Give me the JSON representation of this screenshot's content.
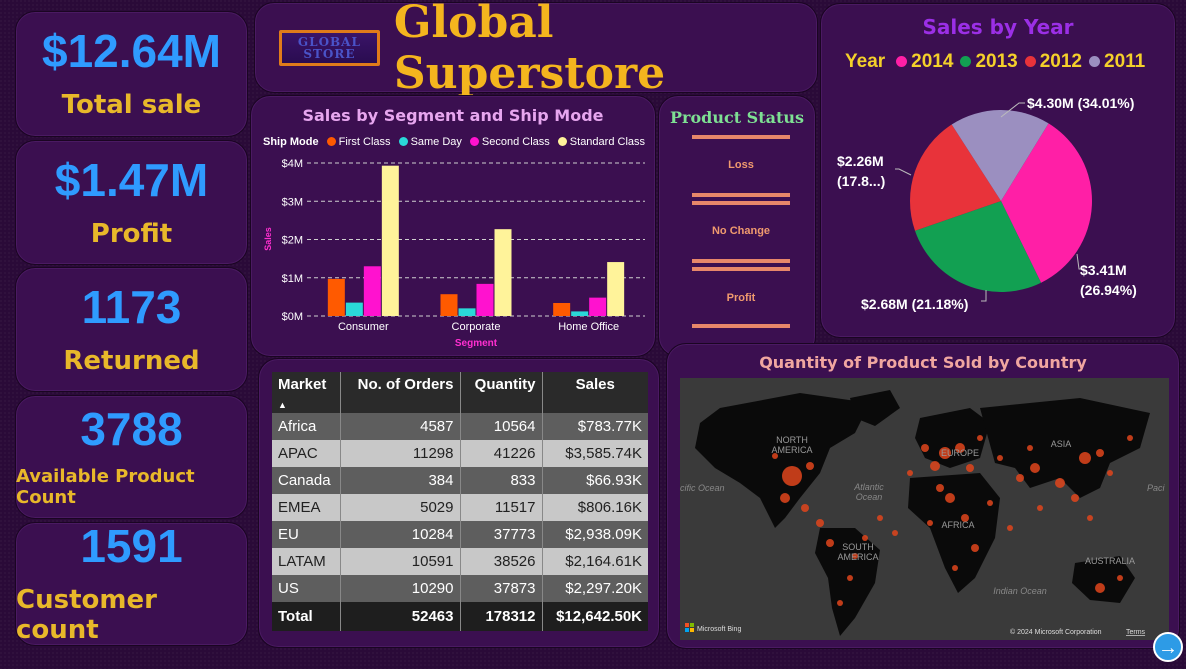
{
  "kpis": [
    {
      "value": "$12.64M",
      "label": "Total sale"
    },
    {
      "value": "$1.47M",
      "label": "Profit"
    },
    {
      "value": "1173",
      "label": "Returned"
    },
    {
      "value": "3788",
      "label": "Available Product Count"
    },
    {
      "value": "1591",
      "label": "Customer count"
    }
  ],
  "header": {
    "logo_line1": "GLOBAL",
    "logo_line2": "STORE",
    "title": "Global Superstore"
  },
  "segment_chart": {
    "title": "Sales by Segment and Ship Mode",
    "legend_title": "Ship Mode",
    "xlabel": "Segment",
    "ylabel": "Sales"
  },
  "product_status": {
    "title": "Product Status",
    "items": [
      "Loss",
      "No Change",
      "Profit"
    ]
  },
  "year_chart": {
    "title": "Sales by Year",
    "legend_title": "Year",
    "slice_labels": {
      "s2014": "$4.30M (34.01%)",
      "s2013_line1": "$3.41M",
      "s2013_line2": "(26.94%)",
      "s2012": "$2.68M (21.18%)",
      "s2011_line1": "$2.26M",
      "s2011_line2": "(17.8...)"
    }
  },
  "table": {
    "headers": [
      "Market",
      "No. of Orders",
      "Quantity",
      "Sales"
    ],
    "rows": [
      [
        "Africa",
        "4587",
        "10564",
        "$783.77K"
      ],
      [
        "APAC",
        "11298",
        "41226",
        "$3,585.74K"
      ],
      [
        "Canada",
        "384",
        "833",
        "$66.93K"
      ],
      [
        "EMEA",
        "5029",
        "11517",
        "$806.16K"
      ],
      [
        "EU",
        "10284",
        "37773",
        "$2,938.09K"
      ],
      [
        "LATAM",
        "10591",
        "38526",
        "$2,164.61K"
      ],
      [
        "US",
        "10290",
        "37873",
        "$2,297.20K"
      ]
    ],
    "total": [
      "Total",
      "52463",
      "178312",
      "$12,642.50K"
    ]
  },
  "map": {
    "title": "Quantity of Product Sold by Country",
    "labels": {
      "north_america_1": "NORTH",
      "north_america_2": "AMERICA",
      "europe": "EUROPE",
      "asia": "ASIA",
      "africa": "AFRICA",
      "south_america_1": "SOUTH",
      "south_america_2": "AMERICA",
      "australia": "AUSTRALIA",
      "atlantic_1": "Atlantic",
      "atlantic_2": "Ocean",
      "pacific_left": "cific Ocean",
      "pacific_right": "Paci",
      "indian": "Indian Ocean"
    },
    "bing": "Microsoft Bing",
    "copyright": "© 2024 Microsoft Corporation",
    "terms": "Terms"
  },
  "next_button": "→",
  "chart_data": [
    {
      "type": "bar",
      "title": "Sales by Segment and Ship Mode",
      "xlabel": "Segment",
      "ylabel": "Sales",
      "categories": [
        "Consumer",
        "Corporate",
        "Home Office"
      ],
      "series": [
        {
          "name": "First Class",
          "color": "#ff5a00",
          "values": [
            0.97,
            0.57,
            0.34
          ]
        },
        {
          "name": "Same Day",
          "color": "#2ad8d8",
          "values": [
            0.35,
            0.2,
            0.12
          ]
        },
        {
          "name": "Second Class",
          "color": "#ff12cf",
          "values": [
            1.3,
            0.84,
            0.48
          ]
        },
        {
          "name": "Standard Class",
          "color": "#fff39a",
          "values": [
            3.93,
            2.27,
            1.41
          ]
        }
      ],
      "units": "$M",
      "yticks": [
        "$0M",
        "$1M",
        "$2M",
        "$3M",
        "$4M"
      ],
      "ylim": [
        0,
        4
      ],
      "grid": true,
      "legend": "top-left"
    },
    {
      "type": "pie",
      "title": "Sales by Year",
      "legend": "top",
      "slices": [
        {
          "label": "2014",
          "value": 4.3,
          "percent": 34.01,
          "color": "#ff1fa6"
        },
        {
          "label": "2013",
          "value": 3.41,
          "percent": 26.94,
          "color": "#12a052"
        },
        {
          "label": "2012",
          "value": 2.68,
          "percent": 21.18,
          "color": "#e8333a"
        },
        {
          "label": "2011",
          "value": 2.26,
          "percent": 17.87,
          "color": "#9b8fc0"
        }
      ]
    }
  ]
}
